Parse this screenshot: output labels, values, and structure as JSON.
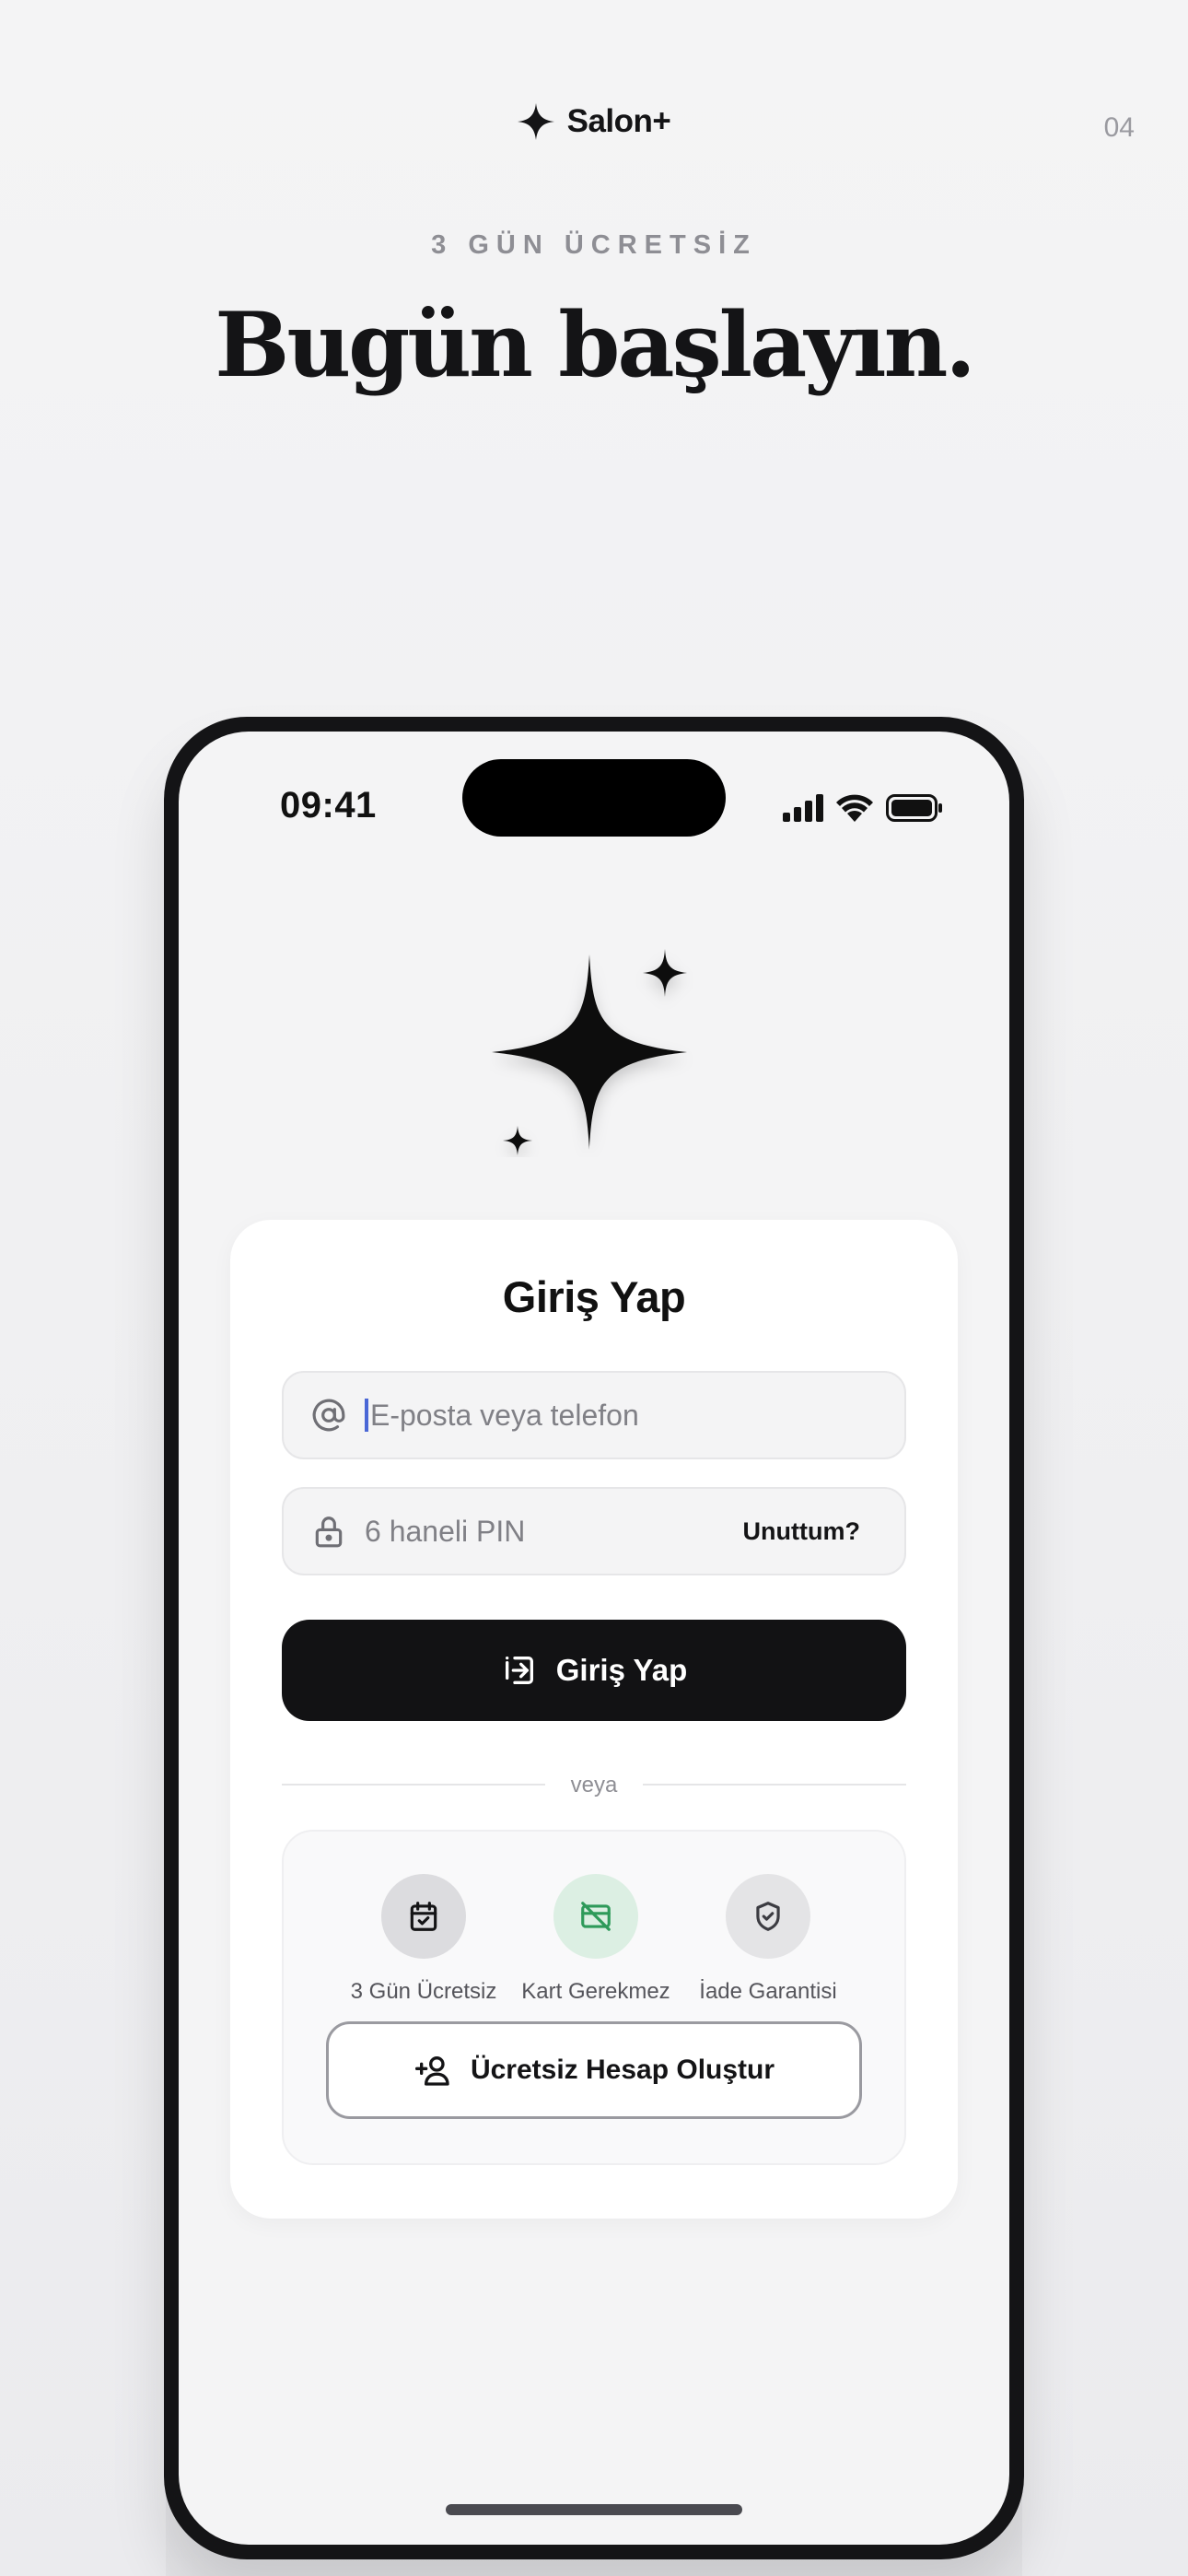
{
  "brand": {
    "name": "Salon+",
    "icon": "sparkle-icon"
  },
  "page_number": "04",
  "eyebrow": "3 GÜN ÜCRETSİZ",
  "headline": "Bugün başlayın.",
  "status_bar": {
    "time": "09:41",
    "icons": [
      "cellular-icon",
      "wifi-icon",
      "battery-icon"
    ]
  },
  "login_card": {
    "title": "Giriş Yap",
    "email_field": {
      "placeholder": "E-posta veya telefon",
      "icon": "at-sign-icon",
      "focused": true
    },
    "pin_field": {
      "placeholder": "6 haneli PIN",
      "icon": "lock-icon",
      "forgot_label": "Unuttum?"
    },
    "login_button": {
      "label": "Giriş Yap",
      "icon": "login-icon"
    },
    "divider_text": "veya",
    "perks": [
      {
        "label": "3 Gün Ücretsiz",
        "icon": "calendar-check-icon"
      },
      {
        "label": "Kart Gerekmez",
        "icon": "card-off-icon"
      },
      {
        "label": "İade Garantisi",
        "icon": "shield-check-icon"
      }
    ],
    "create_button": {
      "label": "Ücretsiz Hesap Oluştur",
      "icon": "user-plus-icon"
    }
  },
  "colors": {
    "primary": "#121214",
    "accent_caret": "#4a67d6",
    "perk_green": "#2e9a5a",
    "perk_green_bg": "#dcefe3"
  }
}
